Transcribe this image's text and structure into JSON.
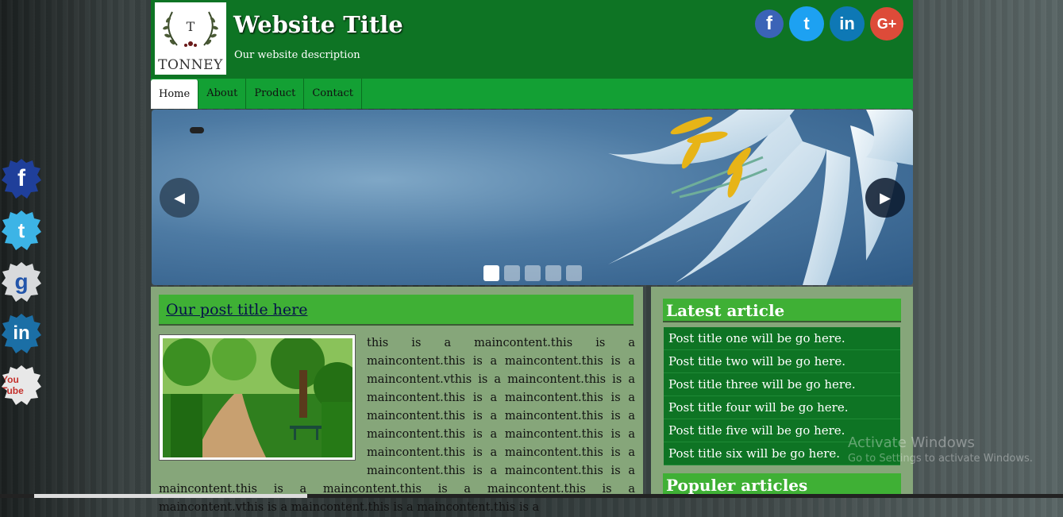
{
  "header": {
    "logo_text": "TONNEY",
    "logo_letter": "T",
    "title": "Website Title",
    "description": "Our website description",
    "social": [
      "f",
      "t",
      "in",
      "G+"
    ]
  },
  "nav": {
    "items": [
      "Home",
      "About",
      "Product",
      "Contact"
    ],
    "active": "Home"
  },
  "slider": {
    "prev_icon": "◀",
    "next_icon": "▶",
    "active_slide": 1,
    "slide_count": 5
  },
  "post": {
    "title": "Our post title here",
    "body": "this is a maincontent.this is a maincontent.this is a maincontent.this is a maincontent.vthis is a maincontent.this is a maincontent.this is a maincontent.this is a maincontent.this is a maincontent.this is a maincontent.this is a maincontent.this is a maincontent.this is a maincontent.this is a maincontent.this is a maincontent.this is a maincontent.this is a maincontent.this is a maincontent.this is a maincontent.vthis is a maincontent.this is a maincontent.this is a"
  },
  "sidebar": {
    "latest_heading": "Latest article",
    "latest_items": [
      "Post title one will be go here.",
      "Post title two will be go here.",
      "Post title three will be go here.",
      "Post title four will be go here.",
      "Post title five will be go here.",
      "Post title six will be go here."
    ],
    "popular_heading": "Populer articles"
  },
  "side_social": [
    "f",
    "t",
    "g",
    "in",
    "You Tube"
  ],
  "watermark": {
    "line1": "Activate Windows",
    "line2": "Go to Settings to activate Windows."
  }
}
